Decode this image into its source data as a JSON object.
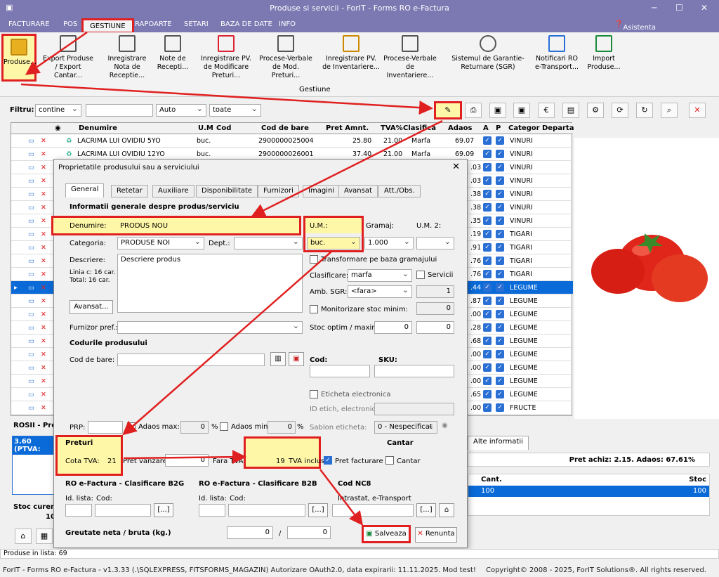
{
  "window": {
    "title": "Produse si servicii - ForIT - Forms RO e-Factura"
  },
  "menu": [
    "FACTURARE",
    "POS",
    "GESTIUNE",
    "RAPOARTE",
    "SETARI",
    "BAZA DE DATE",
    "INFO"
  ],
  "assist": "Asistenta AI - 24/7",
  "ribbon": {
    "items": [
      "Produse...",
      "Export Produse / Export Cantar...",
      "Inregistrare Nota de Receptie...",
      "Note de Recepti...",
      "Inregistrare PV. de Modificare Preturi...",
      "Procese-Verbale de Mod. Preturi...",
      "Inregistrare PV. de Inventariere...",
      "Procese-Verbale de Inventariere...",
      "Sistemul de Garantie-Returnare (SGR)",
      "Notificari RO e-Transport...",
      "Import Produse..."
    ],
    "group": "Gestiune"
  },
  "filter": {
    "label": "Filtru:",
    "mode": "contine",
    "type": "Auto",
    "scope": "toate"
  },
  "grid": {
    "columns": [
      "Denumire",
      "U.M",
      "Cod",
      "Cod de bare",
      "Pret Amnt.",
      "TVA%",
      "Clasifica",
      "Adaos",
      "A",
      "P",
      "Categor",
      "Departa"
    ],
    "rows": [
      {
        "name": "LACRIMA LUI OVIDIU 5YO",
        "um": "buc.",
        "ean": "2900000025004",
        "price": "25.80",
        "tva": "21.00",
        "cls": "Marfa",
        "adaos": "69.07",
        "cat": "VINURI"
      },
      {
        "name": "LACRIMA LUI OVIDIU 12YO",
        "um": "buc.",
        "ean": "2900000026001",
        "price": "37.40",
        "tva": "21.00",
        "cls": "Marfa",
        "adaos": "69.09",
        "cat": "VINURI"
      }
    ],
    "partial": [
      {
        "a": ".03",
        "c": "VINURI"
      },
      {
        "a": ".03",
        "c": "VINURI"
      },
      {
        "a": ".38",
        "c": "VINURI"
      },
      {
        "a": ".38",
        "c": "VINURI"
      },
      {
        "a": ".35",
        "c": "VINURI"
      },
      {
        "a": ".19",
        "c": "TIGARI"
      },
      {
        "a": ".91",
        "c": "TIGARI"
      },
      {
        "a": ".76",
        "c": "TIGARI"
      },
      {
        "a": ".76",
        "c": "TIGARI"
      },
      {
        "a": ".44",
        "c": "LEGUME"
      },
      {
        "a": ".87",
        "c": "LEGUME"
      },
      {
        "a": ".00",
        "c": "LEGUME"
      },
      {
        "a": ".28",
        "c": "LEGUME"
      },
      {
        "a": ".68",
        "c": "LEGUME"
      },
      {
        "a": ".00",
        "c": "LEGUME"
      },
      {
        "a": ".00",
        "c": "LEGUME"
      },
      {
        "a": ".00",
        "c": "LEGUME"
      },
      {
        "a": ".65",
        "c": "LEGUME"
      },
      {
        "a": ".00",
        "c": "FRUCTE"
      }
    ]
  },
  "dialog": {
    "title": "Proprietatile produsului sau a serviciului",
    "tabs": [
      "General",
      "Retetar",
      "Auxiliare",
      "Disponibilitate",
      "Furnizori",
      "Imagini",
      "Avansat",
      "Att./Obs."
    ],
    "sec1": "Informatii generale despre produs/serviciu",
    "denumire_l": "Denumire:",
    "denumire": "PRODUS NOU",
    "um_l": "U.M.:",
    "gramaj_l": "Gramaj:",
    "um2_l": "U.M. 2:",
    "categoria_l": "Categoria:",
    "categoria": "PRODUSE NOI",
    "dept_l": "Dept.:",
    "um": "buc.",
    "gramaj": "1.000",
    "descriere_l": "Descriere:",
    "descriere": "Descriere produs",
    "linia": "Linia c: 16 car.",
    "total": "Total: 16 car.",
    "transformare": "Transformare pe baza gramajului",
    "clasificare_l": "Clasificare:",
    "clasificare": "marfa",
    "servicii": "Servicii",
    "sgr_l": "Amb. SGR:",
    "sgr": "<fara>",
    "sgr_v": "1",
    "avansat_btn": "Avansat...",
    "monitor": "Monitorizare stoc minim:",
    "monitor_v": "0",
    "furnizor_l": "Furnizor pref.:",
    "stoc_l": "Stoc optim / maxim:",
    "stoc1": "0",
    "stoc2": "0",
    "sec2": "Codurile produsului",
    "codbare_l": "Cod de bare:",
    "cod_l": "Cod:",
    "sku_l": "SKU:",
    "eticheta": "Eticheta electronica",
    "idetich": "ID etich, electronica:",
    "prp_l": "PRP:",
    "adaosmax": "Adaos max:",
    "adaosmax_v": "0",
    "adaosmin": "Adaos min:",
    "adaosmin_v": "0",
    "pct": "%",
    "sablon_l": "Sablon eticheta:",
    "sablon": "0 - Nespecificat",
    "preturi": "Preturi",
    "cantar_sec": "Cantar",
    "cotatva_l": "Cota TVA:",
    "cotatva": "21",
    "pretv_l": "Pret vanzare:",
    "pretv": "0",
    "faratva": "Fara TVA",
    "tvainclus_v": "19",
    "tvainclus": "TVA inclus",
    "pretfact": "Pret facturare",
    "cantar": "Cantar",
    "b2g": "RO e-Factura - Clasificare B2G",
    "b2b": "RO e-Factura - Clasificare B2B",
    "nc8": "Cod NC8",
    "idlista": "Id. lista:",
    "cod2": "Cod:",
    "intrastat": "Intrastat, e-Transport",
    "dots": "[...]",
    "greutate": "Greutate neta / bruta (kg.)",
    "g1": "0",
    "g2": "0",
    "slash": "/",
    "salveaza": "Salveaza",
    "renunta": "Renunta"
  },
  "lower": {
    "title": "ROSII - Pre",
    "price_box": "3.60 (PTVA:",
    "stoc_l": "Stoc curent",
    "stoc_v": "10",
    "tab": "Alte informatii",
    "pretachiz": "Pret achiz: 2.15. Adaos: 67.61%",
    "cant_h": "Cant.",
    "stoc_h": "Stoc",
    "cant": "100",
    "stoc": "100"
  },
  "status": "Produse in lista: 69",
  "footer_left": "ForIT - Forms RO e-Factura - v1.3.33 (.\\SQLEXPRESS, FITSFORMS_MAGAZIN)  Autorizare OAuth2.0, data expirarii: 11.11.2025. Mod test!",
  "footer_right": "Copyright© 2008 - 2025, ForIT Solutions®. All rights reserved.",
  "colors": {
    "title": "#7c78b2",
    "highlight": "#e02020",
    "selected": "#0a6ad8"
  }
}
